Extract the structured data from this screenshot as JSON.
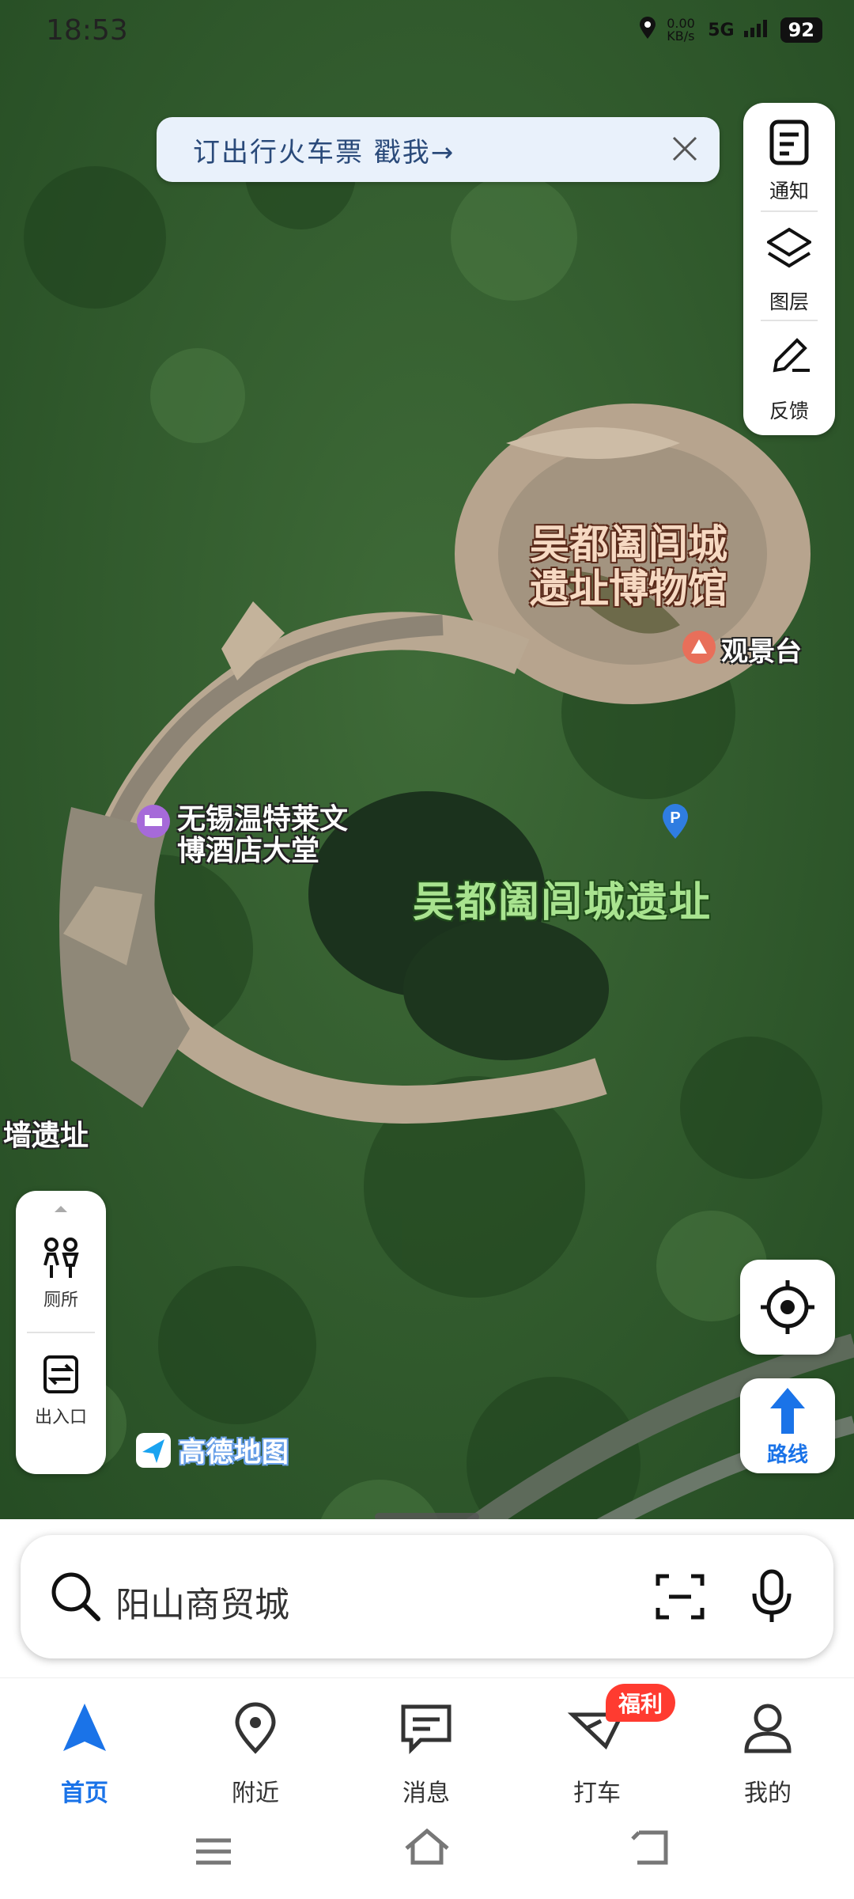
{
  "status_bar": {
    "time": "18:53",
    "net_speed": "0.00 KB/s",
    "network": "5G",
    "battery": "92"
  },
  "banner": {
    "text": "订出行火车票  戳我→"
  },
  "right_panel": {
    "notify_label": "通知",
    "layers_label": "图层",
    "feedback_label": "反馈"
  },
  "map": {
    "labels": {
      "museum_line1": "吴都阖闾城",
      "museum_line2": "遗址博物馆",
      "viewing_platform": "观景台",
      "hotel_line1": "无锡温特莱文",
      "hotel_line2": "博酒店大堂",
      "site": "吴都阖闾城遗址",
      "wall_ruins": "墙遗址"
    },
    "brand": "高德地图"
  },
  "left_panel": {
    "toilet_label": "厕所",
    "entrance_label": "出入口"
  },
  "route_button": {
    "label": "路线"
  },
  "search": {
    "placeholder": "阳山商贸城"
  },
  "tabs": [
    {
      "label": "首页",
      "active": true
    },
    {
      "label": "附近"
    },
    {
      "label": "消息"
    },
    {
      "label": "打车",
      "badge": "福利"
    },
    {
      "label": "我的"
    }
  ],
  "colors": {
    "accent": "#1a73e8",
    "badge": "#ff3b30"
  }
}
